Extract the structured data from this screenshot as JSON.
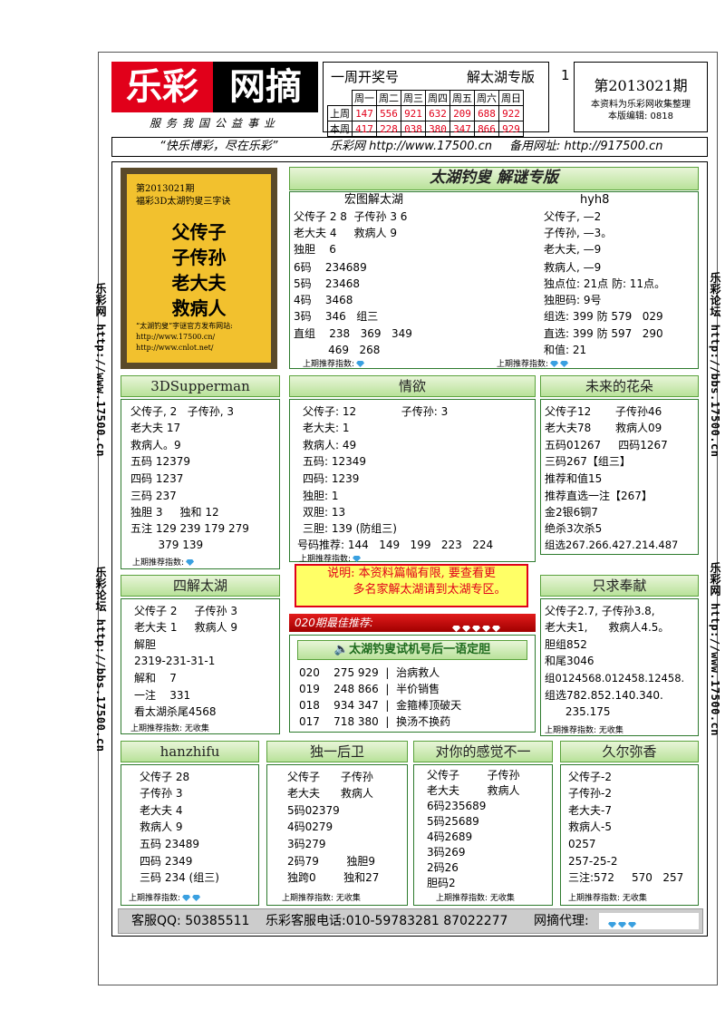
{
  "logo": {
    "left": "乐彩",
    "right": "网摘",
    "slogan": "服务我国公益事业"
  },
  "week": {
    "title": "一周开奖号",
    "special": "解太湖专版",
    "page_no": "1",
    "headers": [
      "周一",
      "周二",
      "周三",
      "周四",
      "周五",
      "周六",
      "周日"
    ],
    "rows": [
      {
        "label": "上周",
        "values": [
          "147",
          "556",
          "921",
          "632",
          "209",
          "688",
          "922"
        ]
      },
      {
        "label": "本周",
        "values": [
          "417",
          "228",
          "038",
          "380",
          "347",
          "866",
          "929"
        ]
      }
    ]
  },
  "issue": {
    "period": "第2013021期",
    "line1": "本资料为乐彩网收集整理",
    "line2": "本版编辑: 0818"
  },
  "urlbar": {
    "motto": "“快乐博彩，尽在乐彩”",
    "site": "乐彩网 http://www.17500.cn",
    "backup": "备用网址: http://917500.cn"
  },
  "side_left": {
    "top": "乐彩网 http://www.17500.cn",
    "bottom": "乐彩论坛 http://bbs.17500.cn"
  },
  "side_right": {
    "top": "乐彩论坛 http://bbs.17500.cn",
    "bottom": "乐彩网 http://www.17500.cn"
  },
  "ad": {
    "head1": "第2013021期",
    "head2": "福彩3D太湖钓叟三字诀",
    "big": [
      "父传子",
      "子传孙",
      "老大夫",
      "救病人"
    ],
    "note1": "“太湖钓叟”字谜官方发布网站:",
    "note2": "http://www.17500.cn/",
    "note3": "http://www.cnlot.net/"
  },
  "taihu": {
    "banner": "太湖钓叟 解谜专版",
    "left_title": "宏图解太湖",
    "right_title": "hyh8",
    "left_lines": [
      "父传子 2 8  子传孙 3 6",
      "老大夫 4     救病人 9",
      "独胆    6",
      "6码    234689",
      "5码    23468",
      "4码    3468",
      "3码    346   组三",
      "直组    238   369   349",
      "          469   268"
    ],
    "right_lines": [
      "父传子, —2",
      "子传孙, —3。",
      "老大夫, —9",
      "救病人, —9",
      "独点位: 21点 防: 11点。",
      "独胆码: 9号",
      "组选: 399 防 579   029",
      "直选: 399 防 597   290",
      "和值: 21"
    ],
    "index": "上期推荐指数:"
  },
  "boxes": {
    "b1": {
      "title": "3DSupperman",
      "lines": [
        "父传子, 2   子传孙, 3",
        "老大夫 17",
        "救病人。9",
        "五码 12379",
        "四码 1237",
        "三码 237",
        "独胆 3     独和 12",
        "五注 129 239 179 279",
        "        379 139"
      ]
    },
    "b2": {
      "title": "情欲",
      "lines": [
        "父传子: 12             子传孙: 3",
        "老大夫: 1",
        "救病人: 49",
        "五码: 12349",
        "四码: 1239",
        "独胆: 1",
        "双胆: 13",
        "三胆: 139 (防组三)",
        "号码推荐: 144   149   199   223   224"
      ]
    },
    "b3": {
      "title": "未来的花朵",
      "lines": [
        "父传子12       子传孙46",
        "老大夫78       救病人09",
        "五码01267     四码1267",
        "三码267【组三】",
        "推荐和值15",
        "推荐直选一注【267】",
        "金2银6铜7",
        "绝杀3次杀5",
        "组选267.266.427.214.487"
      ]
    },
    "b4": {
      "title": "四解太湖",
      "lines": [
        "父传子 2     子传孙 3",
        "老大夫 1     救病人 9",
        "解胆",
        "2319-231-31-1",
        "解和    7",
        "一注    331",
        "看太湖杀尾4568"
      ]
    },
    "b5": {
      "title": "只求奉献",
      "lines": [
        "父传子2.7, 子传孙3.8,",
        "老大夫1,      救病人4.5。",
        "胆组852",
        "和尾3046",
        "组0124568.012458.12458.",
        "组选782.852.140.340.",
        "      235.175"
      ]
    },
    "b6": {
      "title": "hanzhifu",
      "lines": [
        "父传子 28",
        "子传孙 3",
        "老大夫 4",
        "救病人 9",
        "五码 23489",
        "四码 2349",
        "三码 234 (组三)"
      ]
    },
    "b7": {
      "title": "独一后卫",
      "lines": [
        "父传子      子传孙",
        "老大夫      救病人",
        "5码02379",
        "4码0279",
        "3码279",
        "2码79        独胆9",
        "独跨0        独和27"
      ]
    },
    "b8": {
      "title": "对你的感觉不一",
      "lines": [
        "父传子        子传孙",
        "老大夫        救病人",
        "6码235689",
        "5码25689",
        "4码2689",
        "3码269",
        "2码26",
        "胆码2"
      ]
    },
    "b9": {
      "title": "久尔弥香",
      "lines": [
        "父传子-2",
        "子传孙-2",
        "老大夫-7",
        "救病人-5",
        "0257",
        "257-25-2",
        "三注:572     570   257"
      ]
    }
  },
  "notice": {
    "line1": "说明: 本资料篇幅有限, 要查看更",
    "line2": "多名家解太湖请到太湖专区。"
  },
  "best": {
    "title": "020期最佳推荐:"
  },
  "trial": {
    "title": "太湖钓叟试机号后一语定胆",
    "rows": [
      {
        "no": "020",
        "num": "275 929",
        "text": "治病救人"
      },
      {
        "no": "019",
        "num": "248 866",
        "text": "半价销售"
      },
      {
        "no": "018",
        "num": "934 347",
        "text": "金箍棒顶破天"
      },
      {
        "no": "017",
        "num": "718 380",
        "text": "换汤不换药"
      }
    ]
  },
  "index_label": "上期推荐指数:",
  "index_none": "上期推荐指数: 无收集",
  "footer": {
    "qq": "客服QQ: 50385511",
    "phone": "乐彩客服电话:010-59783281 87022277",
    "agent": "网摘代理:"
  },
  "colors": {
    "red": "#e1001a",
    "green": "#2d7a2d",
    "gold": "#f2c12e"
  }
}
